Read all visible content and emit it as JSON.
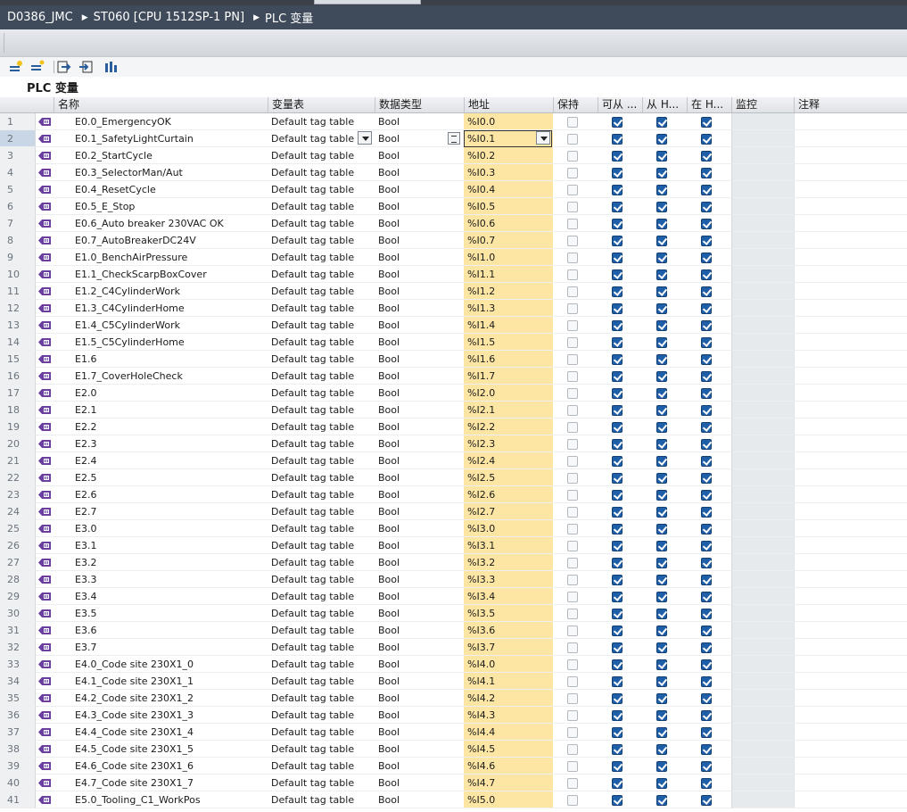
{
  "breadcrumb": {
    "project": "D0386_JMC",
    "device": "ST060 [CPU 1512SP-1 PN]",
    "section": "PLC 变量"
  },
  "toolbar": {
    "icons": [
      "add-tag-icon",
      "insert-row-icon",
      "export-icon",
      "import-icon",
      "monitor-all-icon"
    ]
  },
  "page_title": "PLC 变量",
  "columns": {
    "name": "名称",
    "table": "变量表",
    "type": "数据类型",
    "address": "地址",
    "retain": "保持",
    "hmi_access": "可从 ...",
    "hmi_writable": "从 H...",
    "hmi_visible": "在 H...",
    "monitor": "监控",
    "comment": "注释"
  },
  "colors": {
    "address_bg": "#fde6a4",
    "checkbox_blue": "#1f5fa8",
    "title_bar": "#3f4a5a"
  },
  "rows": [
    {
      "num": "1",
      "name": "E0.0_EmergencyOK",
      "table": "Default tag table",
      "type": "Bool",
      "address": "%I0.0"
    },
    {
      "num": "2",
      "name": "E0.1_SafetyLightCurtain",
      "table": "Default tag table",
      "type": "Bool",
      "address": "%I0.1"
    },
    {
      "num": "3",
      "name": "E0.2_StartCycle",
      "table": "Default tag table",
      "type": "Bool",
      "address": "%I0.2"
    },
    {
      "num": "4",
      "name": "E0.3_SelectorMan/Aut",
      "table": "Default tag table",
      "type": "Bool",
      "address": "%I0.3"
    },
    {
      "num": "5",
      "name": "E0.4_ResetCycle",
      "table": "Default tag table",
      "type": "Bool",
      "address": "%I0.4"
    },
    {
      "num": "6",
      "name": "E0.5_E_Stop",
      "table": "Default tag table",
      "type": "Bool",
      "address": "%I0.5"
    },
    {
      "num": "7",
      "name": "E0.6_Auto breaker 230VAC OK",
      "table": "Default tag table",
      "type": "Bool",
      "address": "%I0.6"
    },
    {
      "num": "8",
      "name": "E0.7_AutoBreakerDC24V",
      "table": "Default tag table",
      "type": "Bool",
      "address": "%I0.7"
    },
    {
      "num": "9",
      "name": "E1.0_BenchAirPressure",
      "table": "Default tag table",
      "type": "Bool",
      "address": "%I1.0"
    },
    {
      "num": "10",
      "name": "E1.1_CheckScarpBoxCover",
      "table": "Default tag table",
      "type": "Bool",
      "address": "%I1.1"
    },
    {
      "num": "11",
      "name": "E1.2_C4CylinderWork",
      "table": "Default tag table",
      "type": "Bool",
      "address": "%I1.2"
    },
    {
      "num": "12",
      "name": "E1.3_C4CylinderHome",
      "table": "Default tag table",
      "type": "Bool",
      "address": "%I1.3"
    },
    {
      "num": "13",
      "name": "E1.4_C5CylinderWork",
      "table": "Default tag table",
      "type": "Bool",
      "address": "%I1.4"
    },
    {
      "num": "14",
      "name": "E1.5_C5CylinderHome",
      "table": "Default tag table",
      "type": "Bool",
      "address": "%I1.5"
    },
    {
      "num": "15",
      "name": "E1.6",
      "table": "Default tag table",
      "type": "Bool",
      "address": "%I1.6"
    },
    {
      "num": "16",
      "name": "E1.7_CoverHoleCheck",
      "table": "Default tag table",
      "type": "Bool",
      "address": "%I1.7"
    },
    {
      "num": "17",
      "name": "E2.0",
      "table": "Default tag table",
      "type": "Bool",
      "address": "%I2.0"
    },
    {
      "num": "18",
      "name": "E2.1",
      "table": "Default tag table",
      "type": "Bool",
      "address": "%I2.1"
    },
    {
      "num": "19",
      "name": "E2.2",
      "table": "Default tag table",
      "type": "Bool",
      "address": "%I2.2"
    },
    {
      "num": "20",
      "name": "E2.3",
      "table": "Default tag table",
      "type": "Bool",
      "address": "%I2.3"
    },
    {
      "num": "21",
      "name": "E2.4",
      "table": "Default tag table",
      "type": "Bool",
      "address": "%I2.4"
    },
    {
      "num": "22",
      "name": "E2.5",
      "table": "Default tag table",
      "type": "Bool",
      "address": "%I2.5"
    },
    {
      "num": "23",
      "name": "E2.6",
      "table": "Default tag table",
      "type": "Bool",
      "address": "%I2.6"
    },
    {
      "num": "24",
      "name": "E2.7",
      "table": "Default tag table",
      "type": "Bool",
      "address": "%I2.7"
    },
    {
      "num": "25",
      "name": "E3.0",
      "table": "Default tag table",
      "type": "Bool",
      "address": "%I3.0"
    },
    {
      "num": "26",
      "name": "E3.1",
      "table": "Default tag table",
      "type": "Bool",
      "address": "%I3.1"
    },
    {
      "num": "27",
      "name": "E3.2",
      "table": "Default tag table",
      "type": "Bool",
      "address": "%I3.2"
    },
    {
      "num": "28",
      "name": "E3.3",
      "table": "Default tag table",
      "type": "Bool",
      "address": "%I3.3"
    },
    {
      "num": "29",
      "name": "E3.4",
      "table": "Default tag table",
      "type": "Bool",
      "address": "%I3.4"
    },
    {
      "num": "30",
      "name": "E3.5",
      "table": "Default tag table",
      "type": "Bool",
      "address": "%I3.5"
    },
    {
      "num": "31",
      "name": "E3.6",
      "table": "Default tag table",
      "type": "Bool",
      "address": "%I3.6"
    },
    {
      "num": "32",
      "name": "E3.7",
      "table": "Default tag table",
      "type": "Bool",
      "address": "%I3.7"
    },
    {
      "num": "33",
      "name": "E4.0_Code site 230X1_0",
      "table": "Default tag table",
      "type": "Bool",
      "address": "%I4.0"
    },
    {
      "num": "34",
      "name": "E4.1_Code site 230X1_1",
      "table": "Default tag table",
      "type": "Bool",
      "address": "%I4.1"
    },
    {
      "num": "35",
      "name": "E4.2_Code site 230X1_2",
      "table": "Default tag table",
      "type": "Bool",
      "address": "%I4.2"
    },
    {
      "num": "36",
      "name": "E4.3_Code site 230X1_3",
      "table": "Default tag table",
      "type": "Bool",
      "address": "%I4.3"
    },
    {
      "num": "37",
      "name": "E4.4_Code site 230X1_4",
      "table": "Default tag table",
      "type": "Bool",
      "address": "%I4.4"
    },
    {
      "num": "38",
      "name": "E4.5_Code site 230X1_5",
      "table": "Default tag table",
      "type": "Bool",
      "address": "%I4.5"
    },
    {
      "num": "39",
      "name": "E4.6_Code site 230X1_6",
      "table": "Default tag table",
      "type": "Bool",
      "address": "%I4.6"
    },
    {
      "num": "40",
      "name": "E4.7_Code site 230X1_7",
      "table": "Default tag table",
      "type": "Bool",
      "address": "%I4.7"
    },
    {
      "num": "41",
      "name": "E5.0_Tooling_C1_WorkPos",
      "table": "Default tag table",
      "type": "Bool",
      "address": "%I5.0"
    }
  ],
  "selected_row": 2
}
